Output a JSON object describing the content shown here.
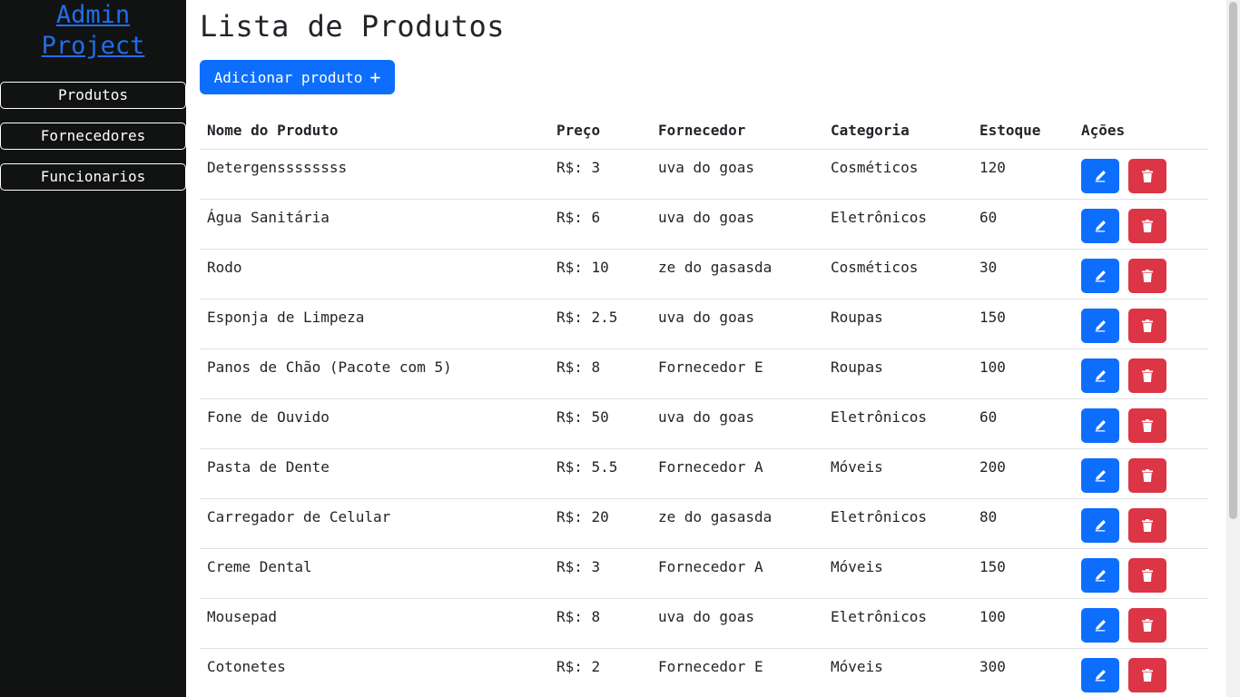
{
  "sidebar": {
    "brand": "Admin Project",
    "items": [
      {
        "label": "Produtos"
      },
      {
        "label": "Fornecedores"
      },
      {
        "label": "Funcionarios"
      }
    ]
  },
  "main": {
    "title": "Lista de Produtos",
    "add_label": "Adicionar produto",
    "add_icon": "+",
    "columns": [
      "Nome do Produto",
      "Preço",
      "Fornecedor",
      "Categoria",
      "Estoque",
      "Ações"
    ],
    "rows": [
      {
        "nome": "Detergenssssssss",
        "preco": "R$: 3",
        "fornecedor": "uva do goas",
        "categoria": "Cosméticos",
        "estoque": "120"
      },
      {
        "nome": "Água Sanitária",
        "preco": "R$: 6",
        "fornecedor": "uva do goas",
        "categoria": "Eletrônicos",
        "estoque": "60"
      },
      {
        "nome": "Rodo",
        "preco": "R$: 10",
        "fornecedor": "ze do gasasda",
        "categoria": "Cosméticos",
        "estoque": "30"
      },
      {
        "nome": "Esponja de Limpeza",
        "preco": "R$: 2.5",
        "fornecedor": "uva do goas",
        "categoria": "Roupas",
        "estoque": "150"
      },
      {
        "nome": "Panos de Chão (Pacote com 5)",
        "preco": "R$: 8",
        "fornecedor": "Fornecedor E",
        "categoria": "Roupas",
        "estoque": "100"
      },
      {
        "nome": "Fone de Ouvido",
        "preco": "R$: 50",
        "fornecedor": "uva do goas",
        "categoria": "Eletrônicos",
        "estoque": "60"
      },
      {
        "nome": "Pasta de Dente",
        "preco": "R$: 5.5",
        "fornecedor": "Fornecedor A",
        "categoria": "Móveis",
        "estoque": "200"
      },
      {
        "nome": "Carregador de Celular",
        "preco": "R$: 20",
        "fornecedor": "ze do gasasda",
        "categoria": "Eletrônicos",
        "estoque": "80"
      },
      {
        "nome": "Creme Dental",
        "preco": "R$: 3",
        "fornecedor": "Fornecedor A",
        "categoria": "Móveis",
        "estoque": "150"
      },
      {
        "nome": "Mousepad",
        "preco": "R$: 8",
        "fornecedor": "uva do goas",
        "categoria": "Eletrônicos",
        "estoque": "100"
      },
      {
        "nome": "Cotonetes",
        "preco": "R$: 2",
        "fornecedor": "Fornecedor E",
        "categoria": "Móveis",
        "estoque": "300"
      }
    ]
  },
  "colors": {
    "sidebar_bg": "#111212",
    "primary": "#0d6efd",
    "danger": "#dc3545",
    "brand_link": "#1f6feb"
  },
  "icons": {
    "edit": "pencil-icon",
    "delete": "trash-icon",
    "add": "plus-icon"
  }
}
